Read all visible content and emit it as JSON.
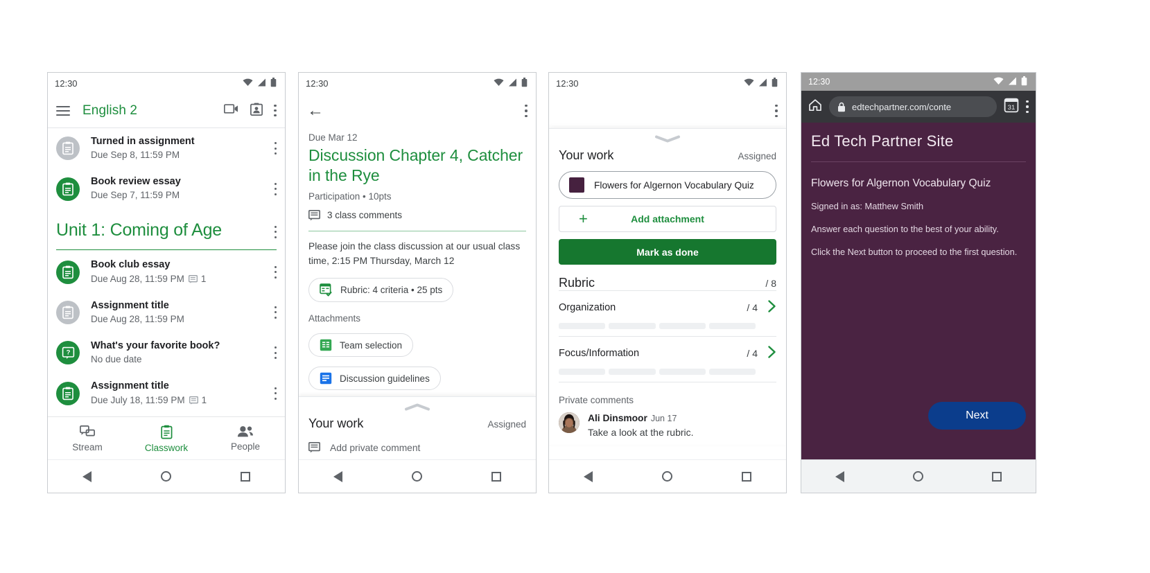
{
  "phone1": {
    "status": {
      "time": "12:30"
    },
    "appbar": {
      "title": "English 2"
    },
    "top_items": [
      {
        "title": "Turned in assignment",
        "sub": "Due Sep 8, 11:59 PM",
        "icon": "assignment-icon",
        "state": "grey"
      },
      {
        "title": "Book review essay",
        "sub": "Due Sep 7, 11:59 PM",
        "icon": "assignment-icon",
        "state": "green"
      }
    ],
    "unit": {
      "title": "Unit 1: Coming of Age"
    },
    "unit_items": [
      {
        "title": "Book club essay",
        "sub": "Due Aug 28, 11:59 PM",
        "comments": "1",
        "icon": "assignment-icon",
        "state": "green"
      },
      {
        "title": "Assignment title",
        "sub": "Due Aug 28, 11:59 PM",
        "comments": "",
        "icon": "assignment-icon",
        "state": "grey"
      },
      {
        "title": "What's your favorite book?",
        "sub": "No due date",
        "comments": "",
        "icon": "question-icon",
        "state": "green"
      },
      {
        "title": "Assignment title",
        "sub": "Due July 18, 11:59 PM",
        "comments": "1",
        "icon": "assignment-icon",
        "state": "green"
      }
    ],
    "bottomnav": [
      {
        "label": "Stream",
        "icon": "stream-icon",
        "active": false
      },
      {
        "label": "Classwork",
        "icon": "classwork-icon",
        "active": true
      },
      {
        "label": "People",
        "icon": "people-icon",
        "active": false
      }
    ]
  },
  "phone2": {
    "status": {
      "time": "12:30"
    },
    "due": "Due Mar 12",
    "title": "Discussion Chapter 4, Catcher in the Rye",
    "meta": "Participation • 10pts",
    "class_comments": "3 class comments",
    "body": "Please join the class discussion at our usual class time, 2:15 PM Thursday, March 12",
    "rubric_chip": "Rubric: 4 criteria • 25 pts",
    "attachments_label": "Attachments",
    "attachments": [
      {
        "label": "Team selection",
        "icon": "sheets-icon"
      },
      {
        "label": "Discussion guidelines",
        "icon": "docs-icon"
      }
    ],
    "sheet": {
      "your_work": "Your work",
      "status": "Assigned",
      "add_private_comment": "Add private comment"
    }
  },
  "phone3": {
    "status": {
      "time": "12:30"
    },
    "sheet": {
      "your_work": "Your work",
      "status": "Assigned",
      "attachment": "Flowers for Algernon Vocabulary Quiz",
      "add_attachment": "Add attachment",
      "mark_as_done": "Mark as done"
    },
    "rubric": {
      "title": "Rubric",
      "total": "/ 8",
      "criteria": [
        {
          "name": "Organization",
          "score": "/ 4",
          "levels": 4
        },
        {
          "name": "Focus/Information",
          "score": "/ 4",
          "levels": 4
        }
      ]
    },
    "private_comments": {
      "title": "Private comments",
      "items": [
        {
          "author": "Ali Dinsmoor",
          "date": "Jun 17",
          "text": "Take a look at the rubric."
        }
      ]
    }
  },
  "phone4": {
    "status": {
      "time": "12:30"
    },
    "browser": {
      "url": "edtechpartner.com/conte",
      "tab_count": "31"
    },
    "site_title": "Ed Tech Partner Site",
    "quiz_title": "Flowers for Algernon Vocabulary Quiz",
    "lines": [
      "Signed in as: Matthew Smith",
      "Answer each question to the best of your ability.",
      "Click the Next button to proceed to the first question."
    ],
    "next_button": "Next"
  },
  "colors": {
    "green": "#1e8e3e",
    "green_dark": "#16772f",
    "purple": "#4a2342",
    "blue": "#0b3d8c",
    "grey": "#5f6368"
  }
}
